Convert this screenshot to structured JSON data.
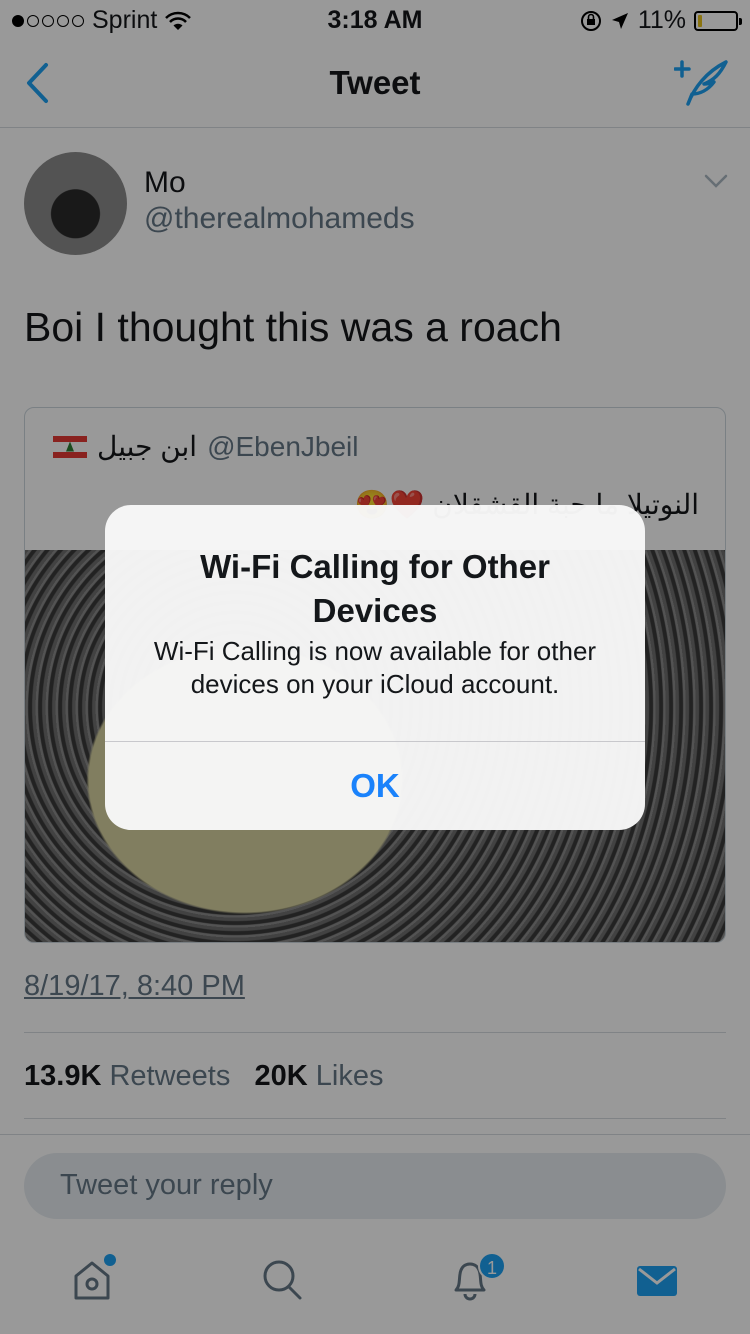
{
  "status_bar": {
    "carrier": "Sprint",
    "time": "3:18 AM",
    "battery_percent": "11%",
    "battery_level": 0.11
  },
  "nav": {
    "title": "Tweet"
  },
  "tweet": {
    "name": "Mo",
    "handle": "@therealmohameds",
    "text": "Boi I thought this was a roach",
    "date": "8/19/17, 8:40 PM",
    "retweets": "13.9K",
    "retweets_label": "Retweets",
    "likes": "20K",
    "likes_label": "Likes"
  },
  "quoted": {
    "name": "ابن جبيل",
    "handle": "@EbenJbeil",
    "text": "النوتيلا ما حبة القشقلان ❤️😍"
  },
  "reply": {
    "placeholder": "Tweet your reply"
  },
  "tabbar": {
    "notifications_badge": "1"
  },
  "alert": {
    "title": "Wi-Fi Calling for Other Devices",
    "message": "Wi-Fi Calling is now available for other devices on your iCloud account.",
    "ok_label": "OK"
  },
  "colors": {
    "accent": "#1da1f2",
    "ios_blue": "#1a82fb",
    "muted": "#657786"
  }
}
